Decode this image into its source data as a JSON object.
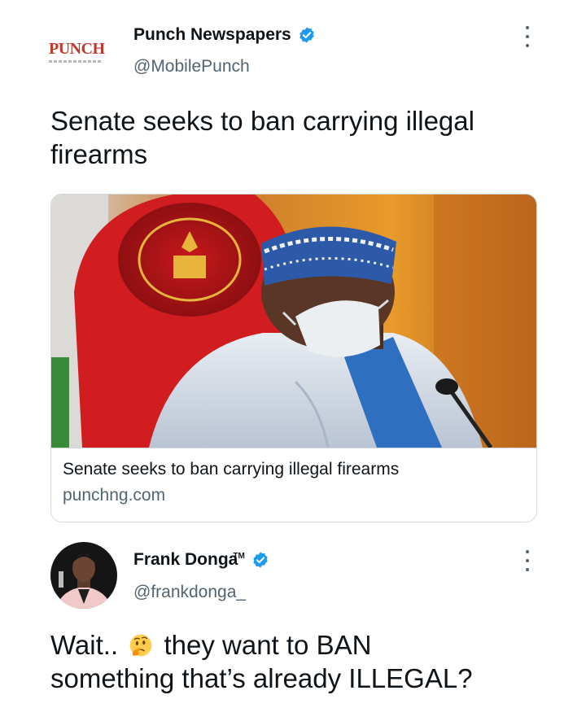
{
  "tweet1": {
    "logo_text": "PUNCH",
    "display_name": "Punch Newspapers",
    "handle": "@MobilePunch",
    "text_line1": "Senate seeks to ban carrying illegal",
    "text_line2": "firearms",
    "card": {
      "title": "Senate seeks to ban carrying illegal firearms",
      "domain": "punchng.com"
    }
  },
  "tweet2": {
    "display_name": "Frank Donga",
    "trademark": "TM",
    "handle": "@frankdonga_",
    "text_before_emoji": "Wait..",
    "emoji": "thinking-face",
    "text_after_emoji": "they want to BAN",
    "text_line2": "something that’s already ILLEGAL?"
  },
  "colors": {
    "verified_blue": "#1d9bf0",
    "secondary_text": "#536471",
    "punch_red": "#c0392b"
  }
}
